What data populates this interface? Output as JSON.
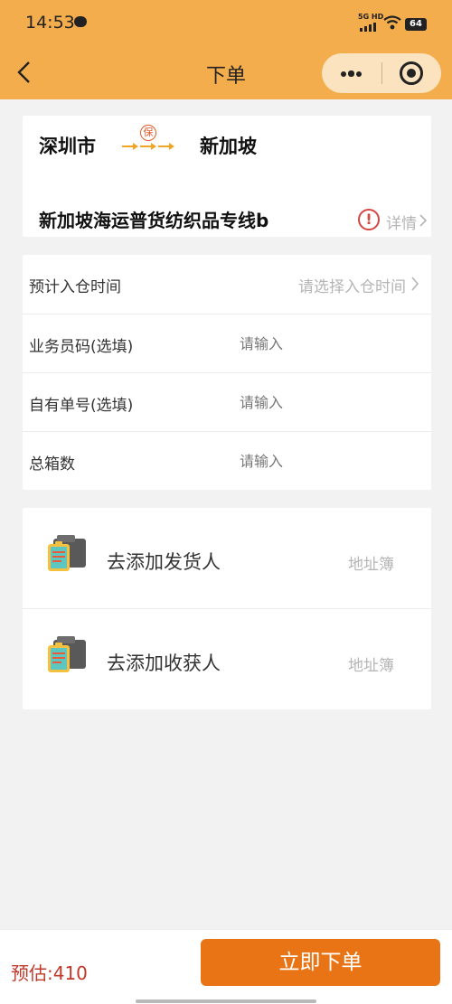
{
  "status_bar": {
    "time": "14:53",
    "network": "5G HD",
    "battery": "64"
  },
  "nav": {
    "title": "下单"
  },
  "route": {
    "from": "深圳市",
    "to": "新加坡",
    "badge": "保",
    "line_name": "新加坡海运普货纺织品专线b",
    "detail_label": "详情"
  },
  "form": {
    "rows": [
      {
        "label": "预计入仓时间",
        "placeholder": "请选择入仓时间"
      },
      {
        "label": "业务员码(选填)",
        "placeholder": "请输入"
      },
      {
        "label": "自有单号(选填)",
        "placeholder": "请输入"
      },
      {
        "label": "总箱数",
        "placeholder": "请输入"
      }
    ]
  },
  "contacts": {
    "sender": {
      "label": "去添加发货人",
      "address_book": "地址簿"
    },
    "receiver": {
      "label": "去添加收获人",
      "address_book": "地址簿"
    }
  },
  "bottom": {
    "estimate": "预估:410",
    "submit_label": "立即下单"
  },
  "colors": {
    "header": "#f4ad4c",
    "accent": "#e87415",
    "price": "#c0392b",
    "warning": "#d64545"
  },
  "icons": [
    "chat-icon",
    "wifi-icon",
    "back-icon",
    "more-icon",
    "target-icon",
    "warning-icon",
    "chevron-right-icon",
    "clipboard-box-icon"
  ]
}
